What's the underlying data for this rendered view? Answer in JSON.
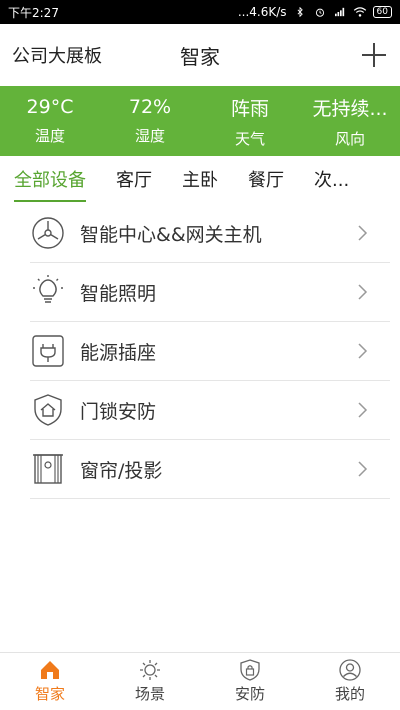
{
  "status_bar": {
    "time": "下午2:27",
    "network_speed": "...4.6K/s",
    "battery": "60"
  },
  "header": {
    "org_name": "公司大展板",
    "title": "智家",
    "add_icon": "plus-icon"
  },
  "weather": [
    {
      "value": "29°C",
      "label": "温度"
    },
    {
      "value": "72%",
      "label": "湿度"
    },
    {
      "value": "阵雨",
      "label": "天气"
    },
    {
      "value": "无持续...",
      "label": "风向"
    }
  ],
  "tabs": {
    "items": [
      "全部设备",
      "客厅",
      "主卧",
      "餐厅"
    ],
    "overflow_label": "次...",
    "active_index": 0
  },
  "devices": [
    {
      "label": "智能中心&&网关主机",
      "icon": "gateway-icon"
    },
    {
      "label": "智能照明",
      "icon": "lightbulb-icon"
    },
    {
      "label": "能源插座",
      "icon": "plug-icon"
    },
    {
      "label": "门锁安防",
      "icon": "house-shield-icon"
    },
    {
      "label": "窗帘/投影",
      "icon": "curtain-icon"
    }
  ],
  "bottom_nav": [
    {
      "label": "智家",
      "icon": "home-icon",
      "active": true
    },
    {
      "label": "场景",
      "icon": "scene-icon",
      "active": false
    },
    {
      "label": "安防",
      "icon": "lock-shield-icon",
      "active": false
    },
    {
      "label": "我的",
      "icon": "user-icon",
      "active": false
    }
  ],
  "colors": {
    "accent_green": "#63b33a",
    "active_tab": "#58a531",
    "active_nav": "#f07a1a"
  }
}
